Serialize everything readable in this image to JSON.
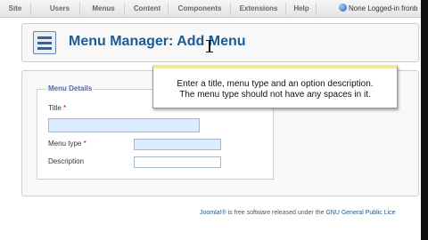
{
  "topbar": {
    "menu": [
      "Site",
      "Users",
      "Menus",
      "Content",
      "Components",
      "Extensions",
      "Help"
    ],
    "status_text": "None Logged-in fronb"
  },
  "header": {
    "title": "Menu Manager: Add Menu"
  },
  "form": {
    "legend": "Menu Details",
    "title_label": "Title",
    "menu_type_label": "Menu type",
    "description_label": "Description",
    "required_mark": "*"
  },
  "tooltip": {
    "line1": "Enter a title, menu type and an option description.",
    "line2": "The menu type should not have any spaces in it."
  },
  "footer": {
    "link1": "Joomla!®",
    "text": " is free software released under the ",
    "link2": "GNU General Public Lice"
  },
  "colors": {
    "accent": "#1c5b94",
    "input_bg": "#dcecff",
    "tooltip_bar": "#f3e99b"
  },
  "icons": {
    "menu_manager": "menu-manager-icon",
    "status": "status-icon"
  }
}
